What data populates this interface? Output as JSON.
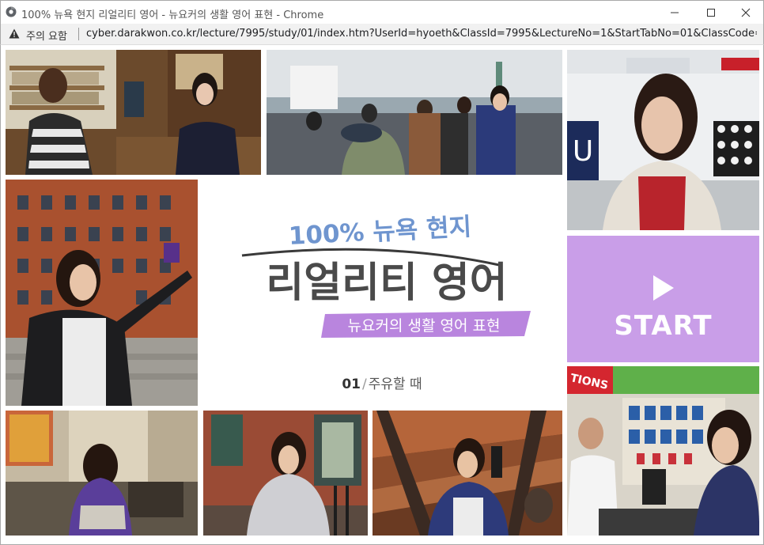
{
  "window": {
    "title": "100% 뉴욕 현지 리얼리티 영어 - 뉴요커의 생활 영어 표현 - Chrome"
  },
  "addressbar": {
    "warning": "주의 요함",
    "url": "cyber.darakwon.co.kr/lecture/7995/study/01/index.htm?UserId=hyoeth&ClassId=7995&LectureNo=1&StartTabNo=01&ClassCode=1358..."
  },
  "brand": {
    "line1": "100% 뉴욕 현지",
    "line2": "리얼리티 영어",
    "line3": "뉴요커의 생활 영어 표현"
  },
  "lesson": {
    "number": "01",
    "separator": "/",
    "title": "주유할 때"
  },
  "start": {
    "label": "START"
  },
  "photos": {
    "store_sign": "TIONS"
  },
  "colors": {
    "start_bg": "#c99ee8",
    "ribbon": "#b985de",
    "title_blue": "#6f95cf",
    "title_dark": "#4a4a4a"
  }
}
